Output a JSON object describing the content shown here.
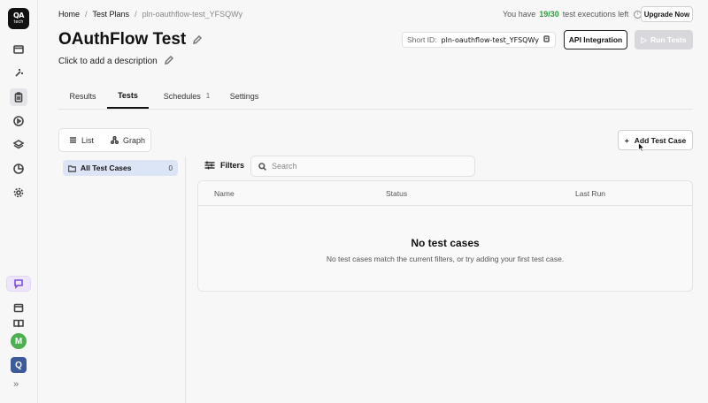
{
  "sidebar": {
    "logo_line1": "QA",
    "logo_line2": "tech",
    "avatar_m": "M",
    "avatar_q": "Q",
    "expand": "»"
  },
  "breadcrumb": {
    "home": "Home",
    "sep": "/",
    "test_plans": "Test Plans",
    "current": "pln-oauthflow-test_YFSQWy"
  },
  "executions": {
    "prefix": "You have",
    "count": "19/30",
    "suffix": "test executions left"
  },
  "upgrade_label": "Upgrade Now",
  "plan": {
    "title": "OAuthFlow Test",
    "description": "Click to add a description",
    "short_id_label": "Short ID:",
    "short_id_value": "pln-oauthflow-test_YFSQWy"
  },
  "buttons": {
    "api": "API Integration",
    "run": "Run Tests",
    "add_test_case": "Add Test Case"
  },
  "tabs": [
    {
      "label": "Results"
    },
    {
      "label": "Tests"
    },
    {
      "label": "Schedules",
      "badge": "1"
    },
    {
      "label": "Settings"
    }
  ],
  "view": {
    "list": "List",
    "graph": "Graph"
  },
  "folders": {
    "all_label": "All Test Cases",
    "all_count": "0"
  },
  "filters_label": "Filters",
  "search": {
    "placeholder": "Search"
  },
  "table": {
    "columns": [
      "Name",
      "Status",
      "Last Run"
    ],
    "empty_title": "No test cases",
    "empty_subtitle": "No test cases match the current filters, or try adding your first test case."
  },
  "colors": {
    "accent_green": "#2e9d3a",
    "chat_purple": "#7c4ddb",
    "folder_selected": "#dbe5f6"
  }
}
